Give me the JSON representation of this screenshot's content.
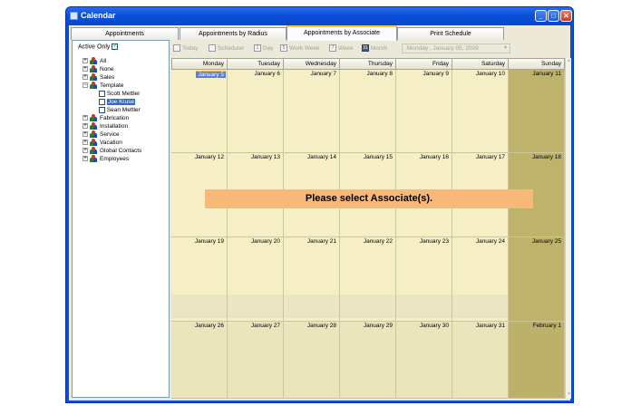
{
  "window": {
    "title": "Calendar"
  },
  "tabs": [
    {
      "label": "Appointments"
    },
    {
      "label": "Appointments by Radius"
    },
    {
      "label": "Appointments by Associate"
    },
    {
      "label": "Print Schedule"
    }
  ],
  "left_panel": {
    "active_only_label": "Active Only",
    "active_only_checked": true,
    "tree": [
      {
        "label": "All"
      },
      {
        "label": "None"
      },
      {
        "label": "Sales"
      },
      {
        "label": "Template"
      },
      {
        "label": "Scott Mettler"
      },
      {
        "label": "Joe Kruse"
      },
      {
        "label": "Sean Mettler"
      },
      {
        "label": "Fabrication"
      },
      {
        "label": "Installation"
      },
      {
        "label": "Service"
      },
      {
        "label": "Vacation"
      },
      {
        "label": "Global Contacts"
      },
      {
        "label": "Employees"
      }
    ]
  },
  "toolbar": {
    "today": "Today",
    "scheduler": "Scheduler",
    "day": "Day",
    "work_week": "Work Week",
    "week": "Week",
    "month": "Month",
    "date_value": "Monday , January 05, 2009",
    "day_icon": "1",
    "work_week_icon": "5",
    "week_icon": "7",
    "month_icon": "31"
  },
  "calendar": {
    "days": [
      "Monday",
      "Tuesday",
      "Wednesday",
      "Thursday",
      "Friday",
      "Saturday",
      "Sunday"
    ],
    "weeks": [
      [
        "January 5",
        "January 6",
        "January 7",
        "January 8",
        "January 9",
        "January 10",
        "January 11"
      ],
      [
        "January 12",
        "January 13",
        "January 14",
        "January 15",
        "January 16",
        "January 17",
        "January 18"
      ],
      [
        "January 19",
        "January 20",
        "January 21",
        "January 22",
        "January 23",
        "January 24",
        "January 25"
      ],
      [
        "January 26",
        "January 27",
        "January 28",
        "January 29",
        "January 30",
        "January 31",
        "February 1"
      ]
    ]
  },
  "message": "Please select Associate(s).",
  "colors": {
    "weekday_cell": "#f6efc6",
    "sunday_cell": "#bfb26b",
    "message_bg": "#f8b878",
    "title_bar": "#0a4fd6"
  }
}
